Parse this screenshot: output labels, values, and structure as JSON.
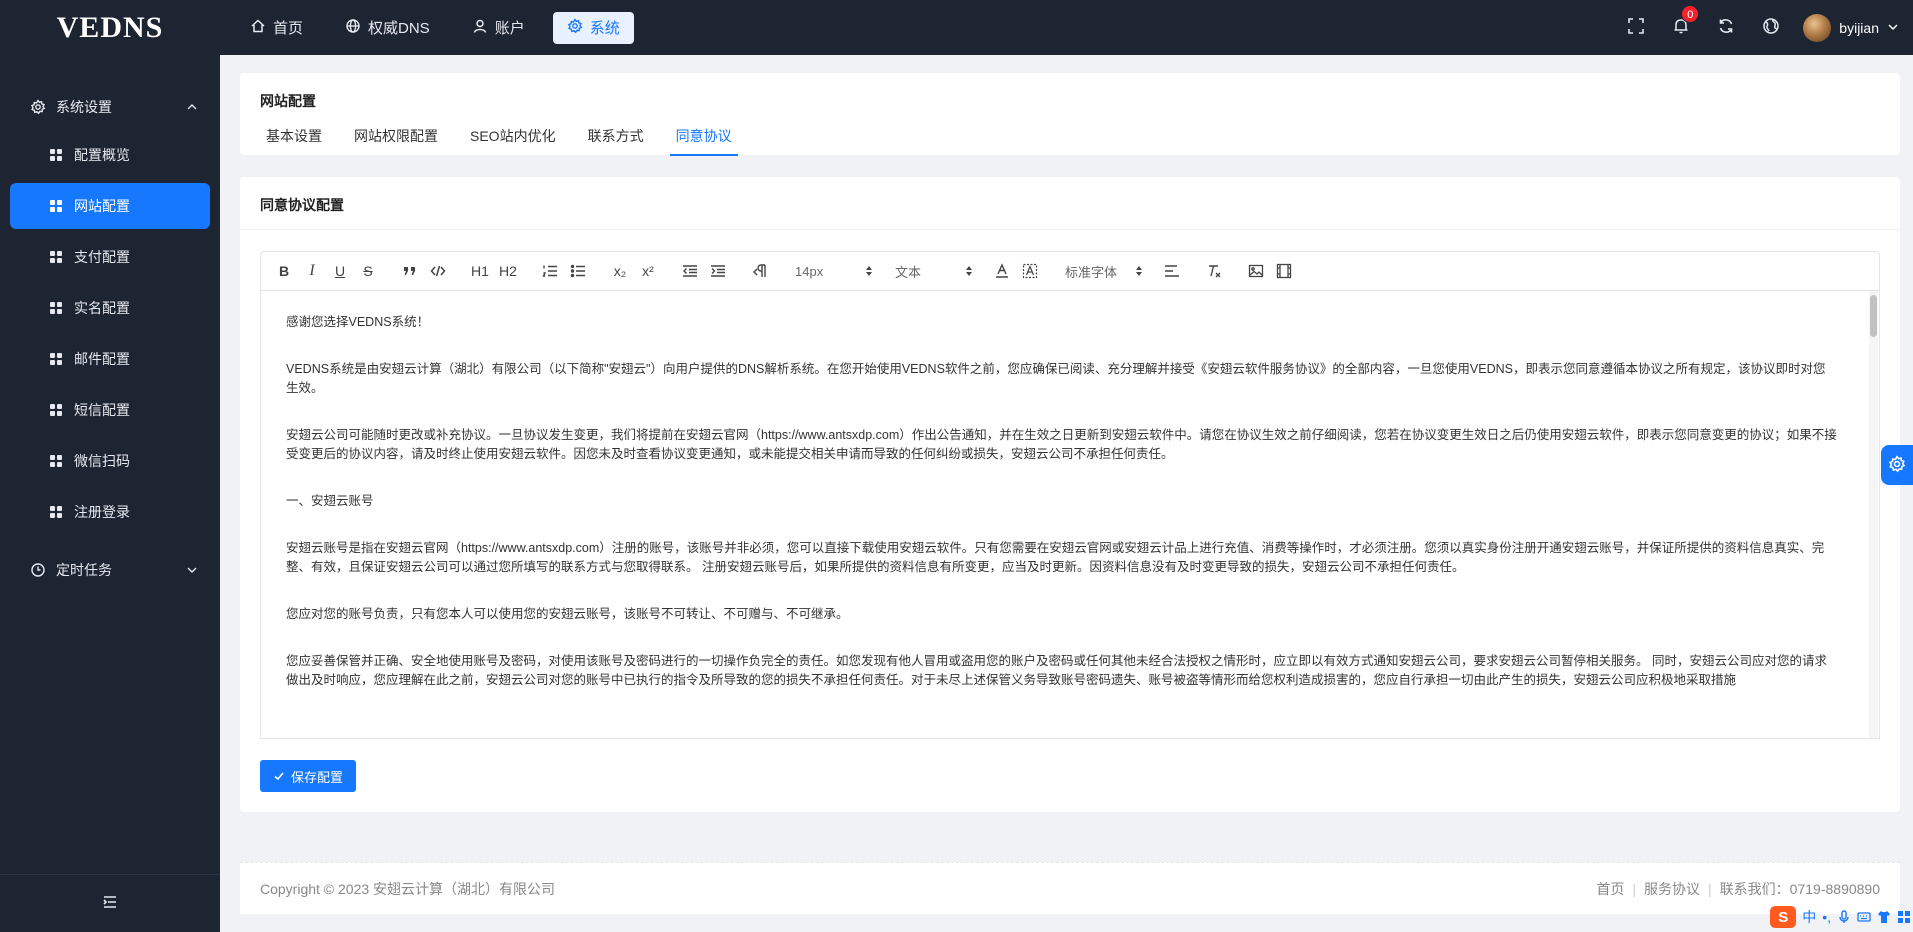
{
  "brand": {
    "logo": "VEDNS"
  },
  "topnav": [
    {
      "label": "首页",
      "icon": "home-icon",
      "active": false
    },
    {
      "label": "权威DNS",
      "icon": "globe-icon",
      "active": false
    },
    {
      "label": "账户",
      "icon": "user-icon",
      "active": false
    },
    {
      "label": "系统",
      "icon": "gear-icon",
      "active": true
    }
  ],
  "header": {
    "notification_count": "0",
    "username": "byijian"
  },
  "sidebar": {
    "group1": "系统设置",
    "items": [
      {
        "label": "配置概览",
        "active": false
      },
      {
        "label": "网站配置",
        "active": true
      },
      {
        "label": "支付配置",
        "active": false
      },
      {
        "label": "实名配置",
        "active": false
      },
      {
        "label": "邮件配置",
        "active": false
      },
      {
        "label": "短信配置",
        "active": false
      },
      {
        "label": "微信扫码",
        "active": false
      },
      {
        "label": "注册登录",
        "active": false
      }
    ],
    "group2": "定时任务"
  },
  "page": {
    "title": "网站配置",
    "tabs": [
      "基本设置",
      "网站权限配置",
      "SEO站内优化",
      "联系方式",
      "同意协议"
    ],
    "active_tab": "同意协议"
  },
  "section": {
    "title": "同意协议配置"
  },
  "toolbar": {
    "bold": "B",
    "italic": "I",
    "underline": "U",
    "strike": "S",
    "h1": "H1",
    "h2": "H2",
    "sub": "x₂",
    "sup": "x²",
    "size": "14px",
    "block": "文本",
    "font": "标准字体"
  },
  "editor": {
    "paragraphs": [
      "感谢您选择VEDNS系统！",
      "VEDNS系统是由安翅云计算（湖北）有限公司（以下简称\"安翅云\"）向用户提供的DNS解析系统。在您开始使用VEDNS软件之前，您应确保已阅读、充分理解并接受《安翅云软件服务协议》的全部内容，一旦您使用VEDNS，即表示您同意遵循本协议之所有规定，该协议即时对您生效。",
      "安翅云公司可能随时更改或补充协议。一旦协议发生变更，我们将提前在安翅云官网（https://www.antsxdp.com）作出公告通知，并在生效之日更新到安翅云软件中。请您在协议生效之前仔细阅读，您若在协议变更生效日之后仍使用安翅云软件，即表示您同意变更的协议；如果不接受变更后的协议内容，请及时终止使用安翅云软件。因您未及时查看协议变更通知，或未能提交相关申请而导致的任何纠纷或损失，安翅云公司不承担任何责任。",
      "一、安翅云账号",
      "安翅云账号是指在安翅云官网（https://www.antsxdp.com）注册的账号，该账号并非必须，您可以直接下载使用安翅云软件。只有您需要在安翅云官网或安翅云计品上进行充值、消费等操作时，才必须注册。您须以真实身份注册开通安翅云账号，并保证所提供的资料信息真实、完整、有效，且保证安翅云公司可以通过您所填写的联系方式与您取得联系。 注册安翅云账号后，如果所提供的资料信息有所变更，应当及时更新。因资料信息没有及时变更导致的损失，安翅云公司不承担任何责任。",
      "您应对您的账号负责，只有您本人可以使用您的安翅云账号，该账号不可转让、不可赠与、不可继承。",
      "您应妥善保管并正确、安全地使用账号及密码，对使用该账号及密码进行的一切操作负完全的责任。如您发现有他人冒用或盗用您的账户及密码或任何其他未经合法授权之情形时，应立即以有效方式通知安翅云公司，要求安翅云公司暂停相关服务。 同时，安翅云公司应对您的请求做出及时响应，您应理解在此之前，安翅云公司对您的账号中已执行的指令及所导致的您的损失不承担任何责任。对于未尽上述保管义务导致账号密码遗失、账号被盗等情形而给您权利造成损害的，您应自行承担一切由此产生的损失，安翅云公司应积极地采取措施"
    ]
  },
  "save_button": "保存配置",
  "footer": {
    "copyright": "Copyright © 2023 安翅云计算（湖北）有限公司",
    "links": [
      "首页",
      "服务协议",
      "联系我们：0719-8890890"
    ]
  },
  "ime": {
    "label": "中"
  }
}
